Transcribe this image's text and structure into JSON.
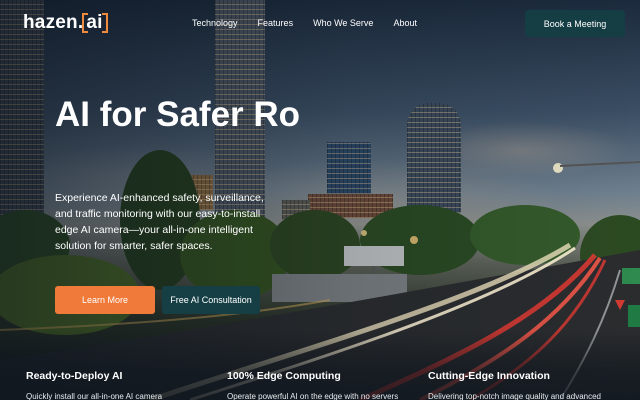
{
  "brand": {
    "name": "hazen",
    "dot": ".",
    "ai": "ai"
  },
  "nav": {
    "links": [
      "Technology",
      "Features",
      "Who We Serve",
      "About"
    ],
    "cta": "Book a Meeting"
  },
  "hero": {
    "title": "AI for Safer Ro",
    "description": "Experience AI-enhanced safety, surveillance, and traffic monitoring with our easy-to-install edge AI camera—your all-in-one intelligent solution for smarter, safer spaces.",
    "primary_button": "Learn More",
    "secondary_button": "Free AI Consultation"
  },
  "features": [
    {
      "title": "Ready-to-Deploy AI",
      "text": "Quickly install our all-in-one AI camera"
    },
    {
      "title": "100% Edge Computing",
      "text": "Operate powerful AI on the edge with no servers"
    },
    {
      "title": "Cutting-Edge Innovation",
      "text": "Delivering top-notch image quality and advanced"
    }
  ],
  "colors": {
    "accent": "#f07a3a",
    "dark_teal": "#153f44",
    "logo_bracket": "#f08a3c"
  }
}
